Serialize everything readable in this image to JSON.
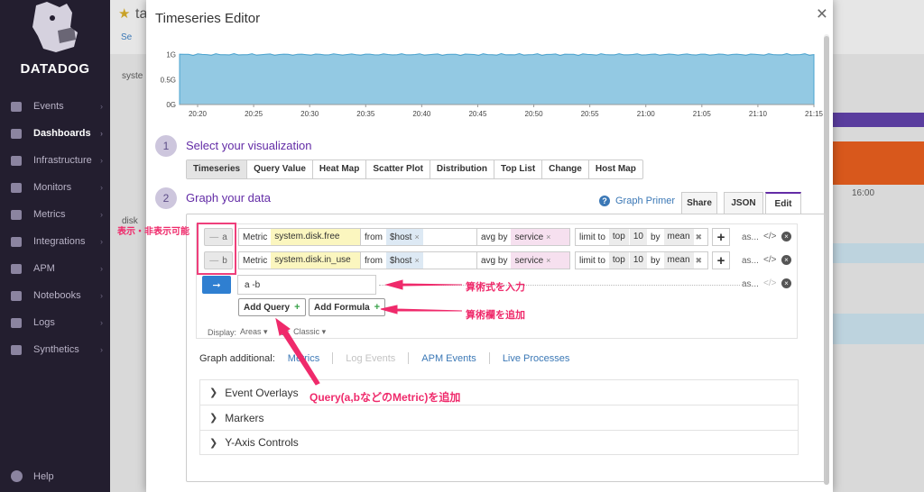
{
  "app": {
    "brand": "DATADOG",
    "nav": [
      {
        "label": "Events",
        "icon": "events-icon"
      },
      {
        "label": "Dashboards",
        "icon": "dashboards-icon",
        "active": true
      },
      {
        "label": "Infrastructure",
        "icon": "infrastructure-icon"
      },
      {
        "label": "Monitors",
        "icon": "monitors-icon"
      },
      {
        "label": "Metrics",
        "icon": "metrics-icon"
      },
      {
        "label": "Integrations",
        "icon": "integrations-icon"
      },
      {
        "label": "APM",
        "icon": "apm-icon"
      },
      {
        "label": "Notebooks",
        "icon": "notebooks-icon"
      },
      {
        "label": "Logs",
        "icon": "logs-icon"
      },
      {
        "label": "Synthetics",
        "icon": "synthetics-icon"
      }
    ],
    "help": "Help",
    "dashboard_title": "ta",
    "search_label": "Se",
    "bg_labels": {
      "system": "syste",
      "disk": "disk",
      "bg_time": "16:00"
    }
  },
  "modal": {
    "title": "Timeseries Editor",
    "close_symbol": "×",
    "step1": {
      "number": "1",
      "title": "Select your visualization"
    },
    "step2": {
      "number": "2",
      "title": "Graph your data"
    },
    "viz_tabs": [
      "Timeseries",
      "Query Value",
      "Heat Map",
      "Scatter Plot",
      "Distribution",
      "Top List",
      "Change",
      "Host Map"
    ],
    "active_viz": "Timeseries",
    "graph_primer": "Graph Primer",
    "editor_tabs": [
      "Share",
      "JSON",
      "Edit"
    ],
    "active_editor_tab": "Edit",
    "queries": [
      {
        "letter": "a",
        "metric_label": "Metric",
        "metric": "system.disk.free",
        "from_label": "from",
        "from": "$host",
        "avg_by_label": "avg by",
        "avg_by": "service",
        "limit_to_label": "limit to",
        "top": "top",
        "count": "10",
        "by_label": "by",
        "by": "mean",
        "alias": "as..."
      },
      {
        "letter": "b",
        "metric_label": "Metric",
        "metric": "system.disk.in_use",
        "from_label": "from",
        "from": "$host",
        "avg_by_label": "avg by",
        "avg_by": "service",
        "limit_to_label": "limit to",
        "top": "top",
        "count": "10",
        "by_label": "by",
        "by": "mean",
        "alias": "as..."
      }
    ],
    "formula": {
      "value": "a -b",
      "alias": "as..."
    },
    "add_query": "Add Query",
    "add_formula": "Add Formula",
    "display_label": "Display:",
    "display_value": "Areas",
    "color_label": "or:",
    "color_value": "Classic",
    "graph_additional_label": "Graph additional:",
    "graph_additional_links": [
      {
        "label": "Metrics",
        "enabled": true
      },
      {
        "label": "Log Events",
        "enabled": false
      },
      {
        "label": "APM Events",
        "enabled": true
      },
      {
        "label": "Live Processes",
        "enabled": true
      }
    ],
    "sections": [
      "Event Overlays",
      "Markers",
      "Y-Axis Controls"
    ]
  },
  "chart_data": {
    "type": "area",
    "x": [
      "20:20",
      "20:25",
      "20:30",
      "20:35",
      "20:40",
      "20:45",
      "20:50",
      "20:55",
      "21:00",
      "21:05",
      "21:10",
      "21:15"
    ],
    "yticks": [
      "1G",
      "0.5G",
      "0G"
    ],
    "ylim": [
      0,
      1.1
    ],
    "values": [
      1.0,
      1.0,
      1.0,
      1.0,
      1.0,
      1.0,
      1.0,
      1.0,
      1.0,
      1.0,
      1.0,
      1.0
    ],
    "fill_color": "#93c9e3",
    "line_color": "#4aa3cf"
  },
  "annotations": {
    "show_hide": "表示・非表示可能",
    "formula_input": "算術式を入力",
    "add_formula_field": "算術欄を追加",
    "add_query": "Query(a,bなどのMetric)を追加"
  },
  "colors": {
    "accent": "#632ca6",
    "annotation": "#ef2a6b",
    "sidebar": "#231e2f",
    "primary_button": "#2f7fd1"
  }
}
